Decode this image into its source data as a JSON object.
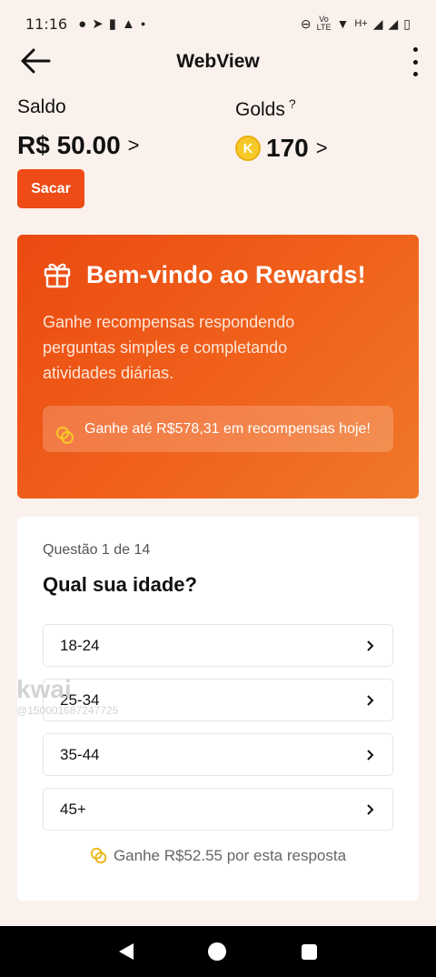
{
  "status_bar": {
    "time": "11:16",
    "lte_top": "Vo",
    "lte_bottom": "LTE",
    "network": "H+"
  },
  "appbar": {
    "title": "WebView"
  },
  "balance": {
    "saldo_label": "Saldo",
    "saldo_value": "R$ 50.00",
    "saldo_chevron": ">",
    "golds_label": "Golds",
    "golds_help": "?",
    "coin_letter": "K",
    "golds_value": "170",
    "golds_chevron": ">",
    "withdraw_label": "Sacar"
  },
  "banner": {
    "title": "Bem-vindo ao Rewards!",
    "description": "Ganhe recompensas respondendo perguntas simples e completando atividades diárias.",
    "note": "Ganhe até R$578,31 em recompensas hoje!"
  },
  "question": {
    "counter": "Questão 1 de 14",
    "title": "Qual sua idade?",
    "options": [
      {
        "label": "18-24"
      },
      {
        "label": "25-34"
      },
      {
        "label": "35-44"
      },
      {
        "label": "45+"
      }
    ],
    "reward": "Ganhe R$52.55 por esta resposta"
  },
  "watermark": {
    "brand": "kwai",
    "id": "@150001687247725"
  },
  "colors": {
    "accent": "#ee4b16",
    "background": "#fbf1ec",
    "coin": "#f7c928"
  }
}
